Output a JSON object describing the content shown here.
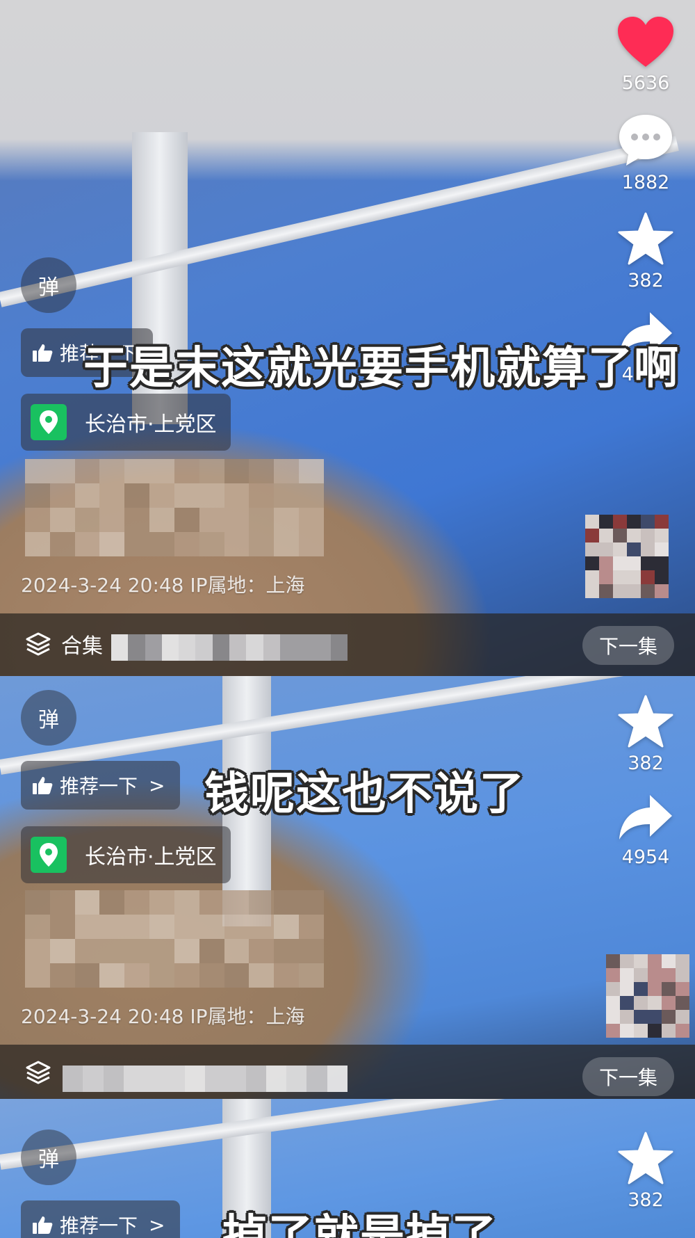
{
  "actions": {
    "like_count": "5636",
    "comment_count": "1882",
    "favorite_count": "382",
    "share_count": "4954"
  },
  "overlay": {
    "danmu_label": "弹",
    "recommend_label": "推荐一下",
    "recommend_chevron": ">",
    "location": "长治市·上党区",
    "date_ip": "2024-3-24 20:48  IP属地：上海",
    "collection_label": "合集",
    "next_episode_label": "下一集"
  },
  "subtitles": [
    "于是末这就光要手机就算了啊",
    "钱呢这也不说了",
    "掉了就是掉了"
  ],
  "colors": {
    "like_red": "#fe2c55",
    "location_green": "#19c160"
  },
  "icons": [
    "heart-icon",
    "comment-icon",
    "star-icon",
    "share-icon",
    "thumbs-up-icon",
    "location-pin-icon",
    "collection-layers-icon"
  ]
}
